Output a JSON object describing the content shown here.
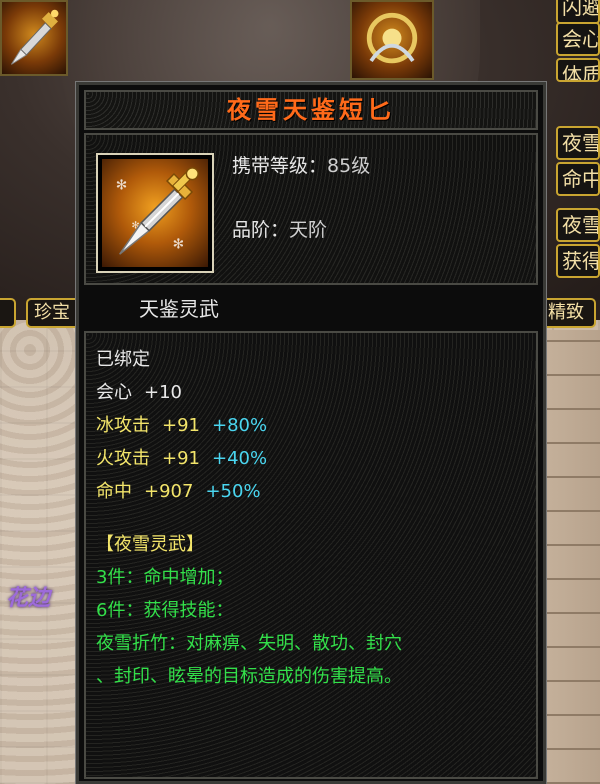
{
  "item": {
    "name": "夜雪天鉴短匕",
    "carry_level_label": "携带等级：",
    "carry_level_value": "85级",
    "grade_label": "品阶：",
    "grade_value": "天阶",
    "category": "天鉴灵武"
  },
  "stats": {
    "bound": "已绑定",
    "lines": [
      {
        "name": "会心",
        "base": "+10",
        "bonus": "",
        "color": "#e8e8e8"
      },
      {
        "name": "冰攻击",
        "base": "+91",
        "bonus": "+80%",
        "color": "#f3e56a"
      },
      {
        "name": "火攻击",
        "base": "+91",
        "bonus": "+40%",
        "color": "#f3e56a"
      },
      {
        "name": "命中",
        "base": "+907",
        "bonus": "+50%",
        "color": "#f3e56a"
      }
    ]
  },
  "set": {
    "title": "【夜雪灵武】",
    "bonus_3": "3件：命中增加；",
    "bonus_6": "6件：获得技能：",
    "skill_line1": "夜雪折竹：对麻痹、失明、散功、封穴",
    "skill_line2": "、封印、眩晕的目标造成的伤害提高。"
  },
  "background": {
    "right_tabs": [
      "闪避",
      "会心",
      "体质",
      "夜雪",
      "命中",
      "夜雪",
      "获得"
    ],
    "bottom_tabs": [
      "珍宝",
      "精致"
    ],
    "left_side_text": "花边"
  },
  "colors": {
    "title": "#ff6a1a",
    "yellow_stat": "#f3e56a",
    "cyan_bonus": "#4ad6f0",
    "set_green": "#33e04a"
  }
}
